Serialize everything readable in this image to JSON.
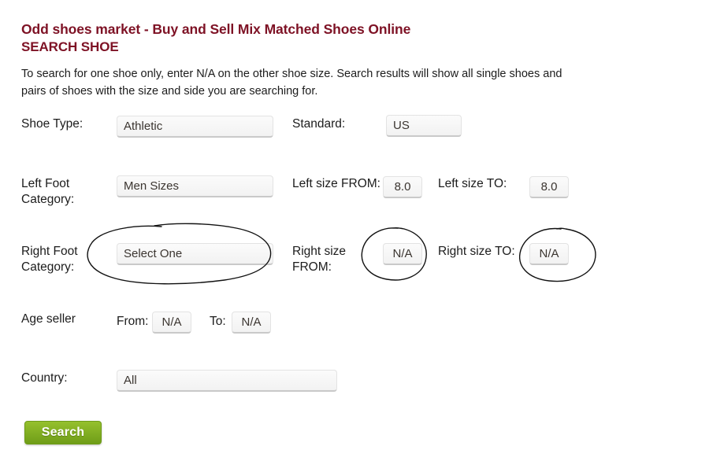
{
  "header": {
    "site_title": "Odd shoes market - Buy and Sell Mix Matched Shoes Online",
    "page_subtitle": "SEARCH SHOE",
    "title_color": "#7e1225"
  },
  "intro": {
    "text": "To search for one shoe only, enter N/A on the other shoe size. Search results will show all single shoes and pairs of shoes with the size and side you are searching for."
  },
  "form": {
    "shoe_type": {
      "label": "Shoe Type:",
      "value": "Athletic"
    },
    "standard": {
      "label": "Standard:",
      "value": "US"
    },
    "left_foot_category": {
      "label": "Left Foot\nCategory:",
      "value": "Men Sizes"
    },
    "left_size_from": {
      "label": "Left size FROM:",
      "value": "8.0"
    },
    "left_size_to": {
      "label": "Left size TO:",
      "value": "8.0"
    },
    "right_foot_category": {
      "label": "Right Foot\nCategory:",
      "value": "Select One"
    },
    "right_size_from": {
      "label": "Right size\nFROM:",
      "value": "N/A"
    },
    "right_size_to": {
      "label": "Right size TO:",
      "value": "N/A"
    },
    "age_seller": {
      "label": "Age seller",
      "from_label": "From:",
      "from_value": "N/A",
      "to_label": "To:",
      "to_value": "N/A"
    },
    "country": {
      "label": "Country:",
      "value": "All"
    },
    "search_button": {
      "label": "Search",
      "color": "#7aa520"
    }
  },
  "annotations": {
    "ink_color": "#111111",
    "marks": [
      {
        "name": "circle-right-foot-category",
        "target": "Select One"
      },
      {
        "name": "circle-right-size-from",
        "target": "N/A"
      },
      {
        "name": "circle-right-size-to",
        "target": "N/A"
      }
    ]
  }
}
